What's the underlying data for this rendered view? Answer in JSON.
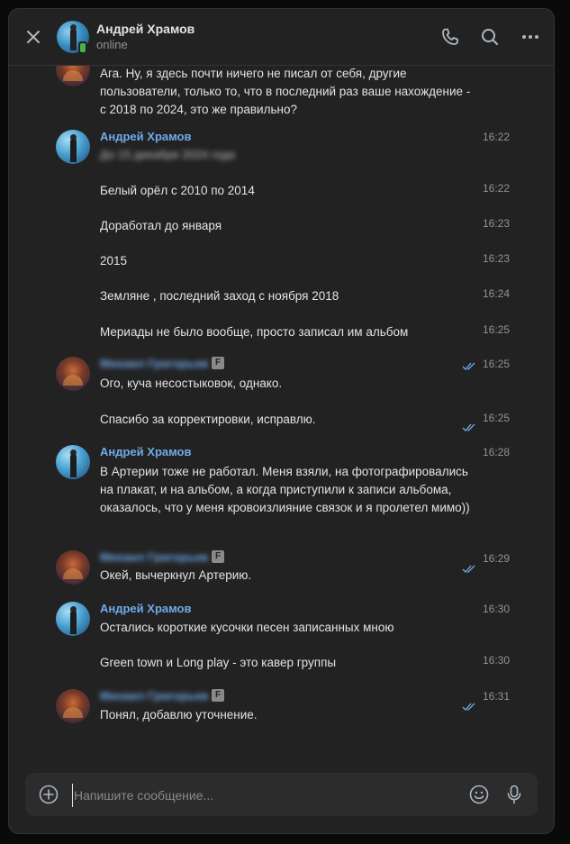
{
  "header": {
    "name": "Андрей Храмов",
    "status": "online"
  },
  "messages": {
    "m0": {
      "text": "Ага. Ну, я здесь почти ничего не писал от себя, другие пользователи, только то, что в последний раз ваше нахождение - с 2018 по 2024, это же правильно?"
    },
    "m1": {
      "sender": "Андрей Храмов",
      "text": "До 15 декабря 2024 года",
      "time": "16:22"
    },
    "m2": {
      "text": "Белый орёл с 2010 по 2014",
      "time": "16:22"
    },
    "m3": {
      "text": "Доработал до января",
      "time": "16:23"
    },
    "m4": {
      "text": "2015",
      "time": "16:23"
    },
    "m5": {
      "text": "Земляне , последний заход с ноября 2018",
      "time": "16:24"
    },
    "m6": {
      "text": "Мериады не было вообще, просто записал им альбом",
      "time": "16:25"
    },
    "m7": {
      "sender": "Михаил Григорьев",
      "badge": "F",
      "text": "Ого, куча несостыковок, однако.",
      "time": "16:25"
    },
    "m8": {
      "text": "Спасибо за корректировки, исправлю.",
      "time": "16:25"
    },
    "m9": {
      "sender": "Андрей Храмов",
      "text": "В Артерии тоже не работал. Меня взяли, на фотографировались на плакат, и на альбом, а когда приступили к записи альбома, оказалось, что у меня кровоизлияние связок и я пролетел мимо))",
      "time": "16:28"
    },
    "m10": {
      "sender": "Михаил Григорьев",
      "badge": "F",
      "text": "Окей, вычеркнул Артерию.",
      "time": "16:29"
    },
    "m11": {
      "sender": "Андрей Храмов",
      "text": "Остались короткие кусочки песен записанных мною",
      "time": "16:30"
    },
    "m12": {
      "text": "Green town и Long play - это кавер группы",
      "time": "16:30"
    },
    "m13": {
      "sender": "Михаил Григорьев",
      "badge": "F",
      "text": "Понял, добавлю уточнение.",
      "time": "16:31"
    }
  },
  "composer": {
    "placeholder": "Напишите сообщение..."
  },
  "icons": {
    "close": "close-icon",
    "call": "phone-icon",
    "search": "search-icon",
    "more": "more-icon",
    "attach": "plus-circle-icon",
    "emoji": "emoji-icon",
    "voice": "microphone-icon",
    "read": "double-check-icon"
  },
  "colors": {
    "accent": "#71aaeb",
    "online": "#4bb34b",
    "background": "#222222"
  }
}
